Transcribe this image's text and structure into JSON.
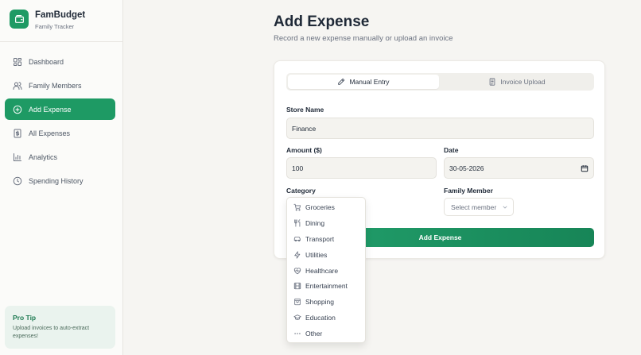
{
  "brand": {
    "title": "FamBudget",
    "subtitle": "Family Tracker"
  },
  "nav": [
    {
      "label": "Dashboard",
      "icon": "dashboard-icon"
    },
    {
      "label": "Family Members",
      "icon": "users-icon"
    },
    {
      "label": "Add Expense",
      "icon": "plus-circle-icon",
      "active": true
    },
    {
      "label": "All Expenses",
      "icon": "receipt-icon"
    },
    {
      "label": "Analytics",
      "icon": "bar-chart-icon"
    },
    {
      "label": "Spending History",
      "icon": "clock-icon"
    }
  ],
  "tip": {
    "title": "Pro Tip",
    "text": "Upload invoices to auto-extract expenses!"
  },
  "page": {
    "title": "Add Expense",
    "subtitle": "Record a new expense manually or upload an invoice"
  },
  "tabs": {
    "manual": "Manual Entry",
    "upload": "Invoice Upload"
  },
  "form": {
    "store_label": "Store Name",
    "store_value": "Finance",
    "amount_label": "Amount ($)",
    "amount_value": "100",
    "date_label": "Date",
    "date_value": "30-05-2026",
    "category_label": "Category",
    "member_label": "Family Member",
    "member_placeholder": "Select member",
    "submit_label": "Add Expense"
  },
  "categories": [
    {
      "label": "Groceries",
      "icon": "cart-icon"
    },
    {
      "label": "Dining",
      "icon": "utensils-icon"
    },
    {
      "label": "Transport",
      "icon": "car-icon"
    },
    {
      "label": "Utilities",
      "icon": "zap-icon"
    },
    {
      "label": "Healthcare",
      "icon": "heart-pulse-icon"
    },
    {
      "label": "Entertainment",
      "icon": "film-icon"
    },
    {
      "label": "Shopping",
      "icon": "shopping-bag-icon"
    },
    {
      "label": "Education",
      "icon": "graduation-cap-icon"
    },
    {
      "label": "Other",
      "icon": "more-icon"
    }
  ],
  "colors": {
    "accent": "#1e9a64",
    "background": "#f6f5f2"
  }
}
